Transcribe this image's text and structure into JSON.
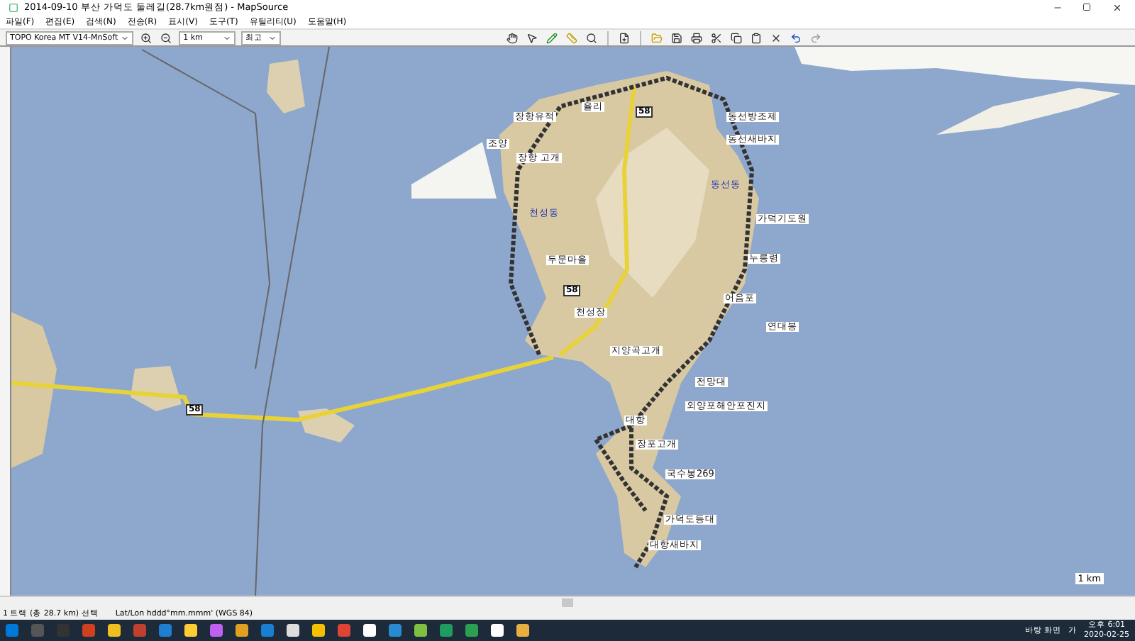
{
  "window": {
    "title": "2014-09-10 부산 가덕도 둘레길(28.7km원점) - MapSource"
  },
  "menu": [
    "파일(F)",
    "편집(E)",
    "검색(N)",
    "전송(R)",
    "표시(V)",
    "도구(T)",
    "유틸리티(U)",
    "도움말(H)"
  ],
  "toolbar": {
    "map_product": "TOPO Korea MT V14-MnSoft",
    "zoom": "1 km",
    "detail": "최고"
  },
  "map": {
    "labels": [
      {
        "text": "장항유적",
        "kind": "waypoint"
      },
      {
        "text": "율리",
        "kind": "waypoint"
      },
      {
        "text": "조양",
        "kind": "waypoint"
      },
      {
        "text": "장항 고개",
        "kind": "waypoint"
      },
      {
        "text": "동선방조제",
        "kind": "waypoint"
      },
      {
        "text": "동선새바지",
        "kind": "waypoint"
      },
      {
        "text": "동선동",
        "kind": "poi"
      },
      {
        "text": "천성동",
        "kind": "poi"
      },
      {
        "text": "가덕기도원",
        "kind": "waypoint"
      },
      {
        "text": "두문마을",
        "kind": "waypoint"
      },
      {
        "text": "누릉령",
        "kind": "waypoint"
      },
      {
        "text": "어음포",
        "kind": "waypoint"
      },
      {
        "text": "천성장",
        "kind": "waypoint"
      },
      {
        "text": "연대봉",
        "kind": "waypoint"
      },
      {
        "text": "지양곡고개",
        "kind": "waypoint"
      },
      {
        "text": "전망대",
        "kind": "waypoint"
      },
      {
        "text": "외양포해안포진지",
        "kind": "waypoint"
      },
      {
        "text": "대항",
        "kind": "waypoint"
      },
      {
        "text": "장포고개",
        "kind": "waypoint"
      },
      {
        "text": "국수봉269",
        "kind": "waypoint"
      },
      {
        "text": "가덕도등대",
        "kind": "waypoint"
      },
      {
        "text": "대항새바지",
        "kind": "waypoint"
      }
    ],
    "route_numbers": [
      "58",
      "58",
      "58"
    ],
    "scale": "1 km"
  },
  "status_bar": {
    "selection": "1 트랙 (총 28.7 km) 선택",
    "position_format": "Lat/Lon hddd°mm.mmm' (WGS 84)"
  },
  "taskbar": {
    "desktop": "바탕 화면",
    "input_mode": "가",
    "time": "오후 6:01",
    "date": "2020-02-25"
  }
}
